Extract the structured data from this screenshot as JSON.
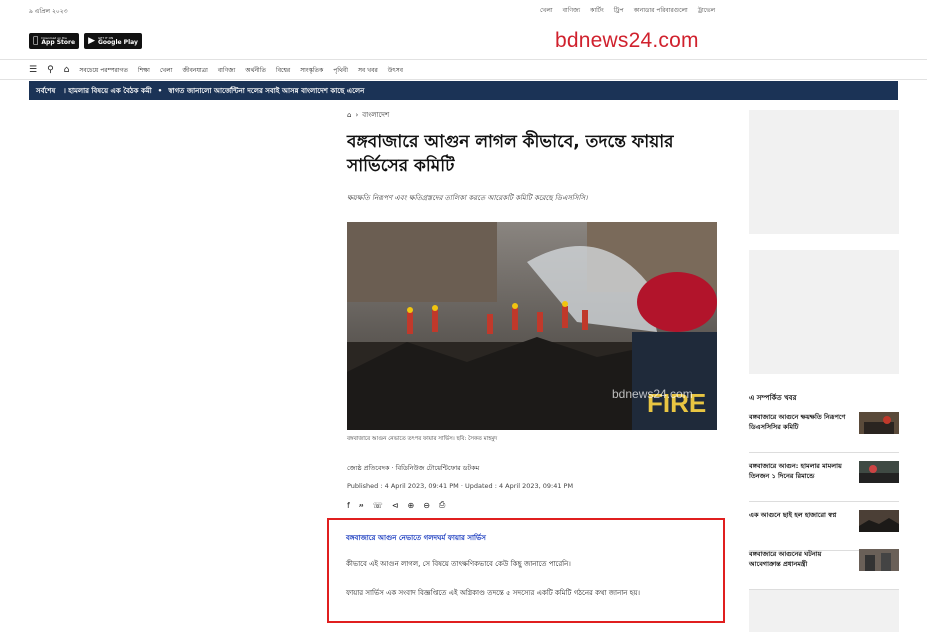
{
  "topbar": {
    "date": "৯ এপ্রিল ২০২৩",
    "links": [
      "খেলা",
      "বাণিজ্য",
      "কার্টিং",
      "ট্রিপ",
      "কানাডার পরিবারগুলো",
      "ট্রাভেল"
    ]
  },
  "store_badges": {
    "app_store": {
      "small": "Download on the",
      "big": "App Store"
    },
    "google_play": {
      "small": "GET IT ON",
      "big": "Google Play"
    }
  },
  "logo": "bdnews24.com",
  "nav": {
    "items": [
      "সবচেয়ে পরম্পরাগত",
      "শিক্ষা",
      "খেলা",
      "জীবনযাত্রা",
      "বাণিজ্য",
      "অর্থনীতি",
      "বিশ্বের",
      "সাংস্কৃতিক",
      "পৃথিবী",
      "সব খবর",
      "উৎসব"
    ]
  },
  "ticker": {
    "label": "সর্বশেষ",
    "items": [
      "। হামলার বিষয়ে এক বৈঠক কমী",
      "স্বাগত জানালো আর্জেন্টিনা দলের সবাই আসন্ন বাংলাদেশ কাছে এলেন"
    ]
  },
  "breadcrumb": {
    "section": "বাংলাদেশ"
  },
  "article": {
    "headline": "বঙ্গবাজারে আগুন লাগল কীভাবে, তদন্তে ফায়ার সার্ভিসের কমিটি",
    "summary": "ক্ষয়ক্ষতি নিরূপণ এবং ক্ষতিগ্রস্তদের তালিকা করতে আরেকটি কমিটি করেছে ডিএসসিসি।",
    "caption": "বঙ্গবাজারে আগুন নেভাতে তৎপর ফায়ার সার্ভিস। ছবি: সৈকত মাহমুদ",
    "watermark": "bdnews24.com",
    "byline": "জ্যেষ্ঠ প্রতিবেদক · বিডিনিউজ টোয়েন্টিফোর ডটকম",
    "published": "Published : 4 April 2023, 09:41 PM",
    "updated": "Updated : 4 April 2023, 09:41 PM",
    "related_link": "বঙ্গবাজারে আগুন নেভাতে গলদঘর্ম ফায়ার সার্ভিস",
    "para1": "কীভাবে এই আগুন লাগল, সে বিষয়ে তাৎক্ষণিকভাবে কেউ কিছু জানাতে পারেনি।",
    "para2": "ফায়ার সার্ভিস এক সংবাদ বিজ্ঞপ্তিতে এই অগ্নিকাণ্ড তদন্তে ৫ সদস্যের একটি কমিটি গঠনের কথা জানান হয়।"
  },
  "share_icons": [
    "facebook-icon",
    "twitter-icon",
    "whatsapp-icon",
    "share-icon",
    "zoom-in-icon",
    "zoom-out-icon",
    "print-icon"
  ],
  "related": {
    "title": "এ সম্পর্কিত খবর",
    "items": [
      {
        "title": "বঙ্গবাজারে আগুনে ক্ষয়ক্ষতি নিরূপণে ডিএসসিসির কমিটি"
      },
      {
        "title": "বঙ্গবাজারে আগুন: হামলার মামলায় তিনজন ১ দিনের রিমান্ডে"
      },
      {
        "title": "এক আগুনে ছাই হল হাজারো স্বপ্ন"
      },
      {
        "title": "বঙ্গবাজারে আগুনের ঘটনায় আবেগাক্রান্ত প্রধানমন্ত্রী"
      }
    ]
  }
}
